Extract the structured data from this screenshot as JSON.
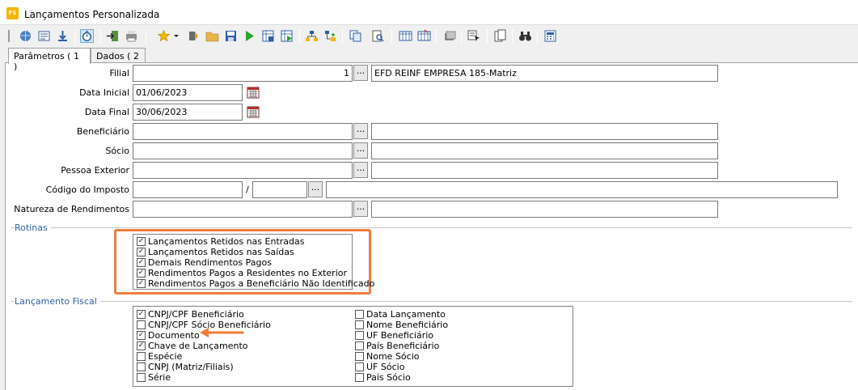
{
  "window": {
    "title": "Lançamentos Personalizada",
    "app_icon_text": "FS"
  },
  "tabs": [
    {
      "label": "Parâmetros ( 1 )"
    },
    {
      "label": "Dados ( 2 )"
    }
  ],
  "form": {
    "filial": {
      "label": "Filial",
      "code": "1",
      "name": "EFD REINF EMPRESA 185-Matriz",
      "lookup": "..."
    },
    "data_inicial": {
      "label": "Data Inicial",
      "value": "01/06/2023"
    },
    "data_final": {
      "label": "Data Final",
      "value": "30/06/2023"
    },
    "beneficiario": {
      "label": "Beneficiário",
      "code": "",
      "name": "",
      "lookup": "..."
    },
    "socio": {
      "label": "Sócio",
      "code": "",
      "name": "",
      "lookup": "..."
    },
    "pessoa_exterior": {
      "label": "Pessoa Exterior",
      "code": "",
      "name": "",
      "lookup": "..."
    },
    "codigo_imposto": {
      "label": "Código do Imposto",
      "code1": "",
      "separator": "/",
      "code2": "",
      "name": "",
      "lookup": "..."
    },
    "natureza_rendimentos": {
      "label": "Natureza de Rendimentos",
      "code": "",
      "name": "",
      "lookup": "..."
    }
  },
  "rotinas": {
    "title": "Rotinas",
    "items": [
      {
        "label": "Lançamentos Retidos nas Entradas",
        "checked": true
      },
      {
        "label": "Lançamentos Retidos nas Saídas",
        "checked": true
      },
      {
        "label": "Demais Rendimentos Pagos",
        "checked": true
      },
      {
        "label": "Rendimentos Pagos a Residentes no Exterior",
        "checked": true
      },
      {
        "label": "Rendimentos Pagos a Beneficiário Não Identificado",
        "checked": true
      }
    ]
  },
  "lancamento_fiscal": {
    "title": "Lançamento Fiscal",
    "col1": [
      {
        "label": "CNPJ/CPF Beneficiário",
        "checked": true
      },
      {
        "label": "CNPJ/CPF Sócio Beneficiário",
        "checked": false
      },
      {
        "label": "Documento",
        "checked": true
      },
      {
        "label": "Chave de Lançamento",
        "checked": true
      },
      {
        "label": "Espécie",
        "checked": false
      },
      {
        "label": "CNPJ (Matriz/Filiais)",
        "checked": false
      },
      {
        "label": "Série",
        "checked": false
      }
    ],
    "col2": [
      {
        "label": "Data Lançamento",
        "checked": false
      },
      {
        "label": "Nome Beneficiário",
        "checked": false
      },
      {
        "label": "UF Beneficiário",
        "checked": false
      },
      {
        "label": "País Beneficiário",
        "checked": false
      },
      {
        "label": "Nome Sócio",
        "checked": false
      },
      {
        "label": "UF Sócio",
        "checked": false
      },
      {
        "label": "País Sócio",
        "checked": false
      }
    ]
  },
  "colors": {
    "highlight": "#f07c3c",
    "section_title": "#2e5fa3"
  }
}
